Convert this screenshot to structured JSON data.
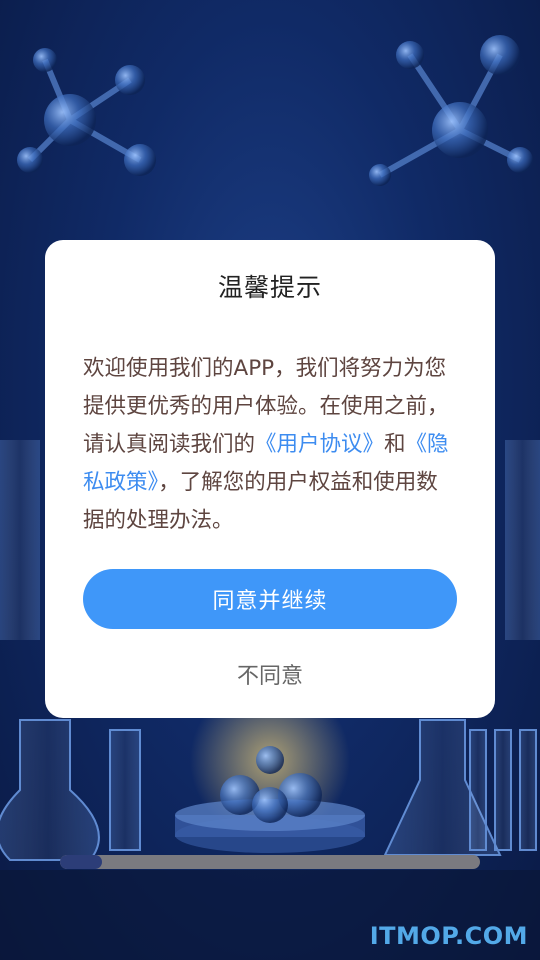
{
  "dialog": {
    "title": "温馨提示",
    "body_part1": "欢迎使用我们的APP，我们将努力为您提供更优秀的用户体验。在使用之前，请认真阅读我们的",
    "link_user_agreement": "《用户协议》",
    "body_and": "和",
    "link_privacy_policy": "《隐私政策》",
    "body_part2": "，了解您的用户权益和使用数据的处理办法。",
    "agree_label": "同意并继续",
    "disagree_label": "不同意"
  },
  "loading": {
    "progress_fraction": 0.1
  },
  "watermark": "ITMOP.COM",
  "colors": {
    "accent": "#3f97f9",
    "link": "#3d8cf0",
    "body_text": "#5e4540",
    "background": "#102a66"
  }
}
